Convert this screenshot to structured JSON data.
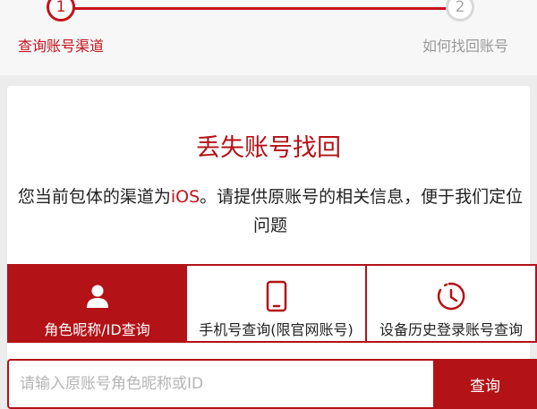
{
  "steps": [
    {
      "number": "1",
      "label": "查询账号渠道"
    },
    {
      "number": "2",
      "label": "如何找回账号"
    }
  ],
  "card": {
    "title": "丢失账号找回",
    "desc_before": "您当前包体的渠道为",
    "channel": "iOS",
    "desc_after": "。请提供原账号的相关信息，便于我们定位问题"
  },
  "tabs": [
    {
      "label": "角色昵称/ID查询",
      "icon": "user-icon",
      "active": true
    },
    {
      "label": "手机号查询(限官网账号)",
      "icon": "phone-icon",
      "active": false
    },
    {
      "label": "设备历史登录账号查询",
      "icon": "clock-icon",
      "active": false
    }
  ],
  "search": {
    "placeholder": "请输入原账号角色昵称或ID",
    "button_label": "查询"
  },
  "colors": {
    "accent": "#b31217",
    "step_inactive": "#d8d8d8",
    "text_muted": "#9a9a9a"
  }
}
